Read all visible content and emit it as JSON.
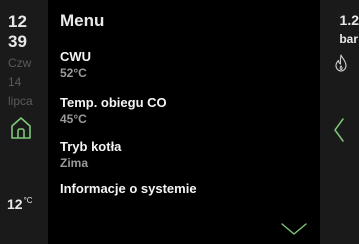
{
  "left": {
    "time_hour": "12",
    "time_minute": "39",
    "day": "Czw",
    "date_day": "14",
    "month": "lipca",
    "outdoor_temp": "12",
    "temp_unit": "°C",
    "icons": {
      "home": "home-icon"
    }
  },
  "menu": {
    "title": "Menu",
    "items": [
      {
        "label": "CWU",
        "value": "52°C"
      },
      {
        "label": "Temp. obiegu CO",
        "value": "45°C"
      },
      {
        "label": "Tryb kotła",
        "value": "Zima"
      },
      {
        "label": "Informacje o systemie"
      }
    ],
    "icons": {
      "scroll": "chevron-down-icon"
    }
  },
  "right": {
    "pressure_value": "1.2",
    "pressure_unit": "bar",
    "icons": {
      "flame": "flame-icon",
      "back": "chevron-left-icon"
    }
  },
  "colors": {
    "accent": "#7ec77a",
    "background": "#000000",
    "panel": "#1a1a1a"
  }
}
